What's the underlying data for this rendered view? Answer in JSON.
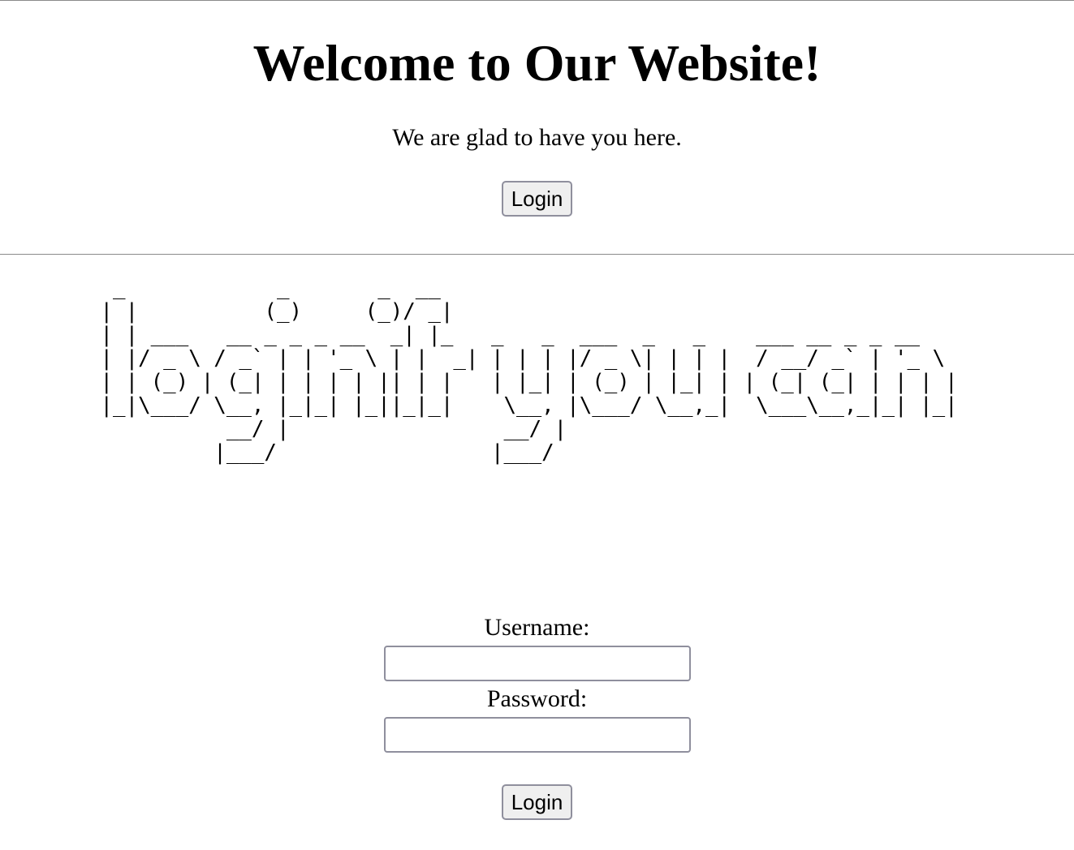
{
  "header": {
    "title": "Welcome to Our Website!",
    "subtitle": "We are glad to have you here.",
    "login_label": "Login"
  },
  "banner": {
    "ascii_art": "  _            _       _  __\n | |          (_)     (_)/ _|\n | | ___   __ _ _ _ __  _| |_   _   _  ___  _   _    ___ __ _ _ __\n | |/ _ \\ / _` | | '_ \\ | |  _| | | | |/ _ \\| | | |  / __/ _` | '_ \\\n | | (_) | (_| | | | | || | |   | |_| | (_) | |_| | | (_| (_| | | | |\n |_|\\___/ \\__, |_|_| |_||_|_|    \\__, |\\___/ \\__,_|  \\___\\__,_|_| |_|\n           __/ |                 __/ |\n          |___/                 |___/"
  },
  "form": {
    "username_label": "Username:",
    "password_label": "Password:",
    "username_value": "",
    "password_value": "",
    "submit_label": "Login"
  }
}
